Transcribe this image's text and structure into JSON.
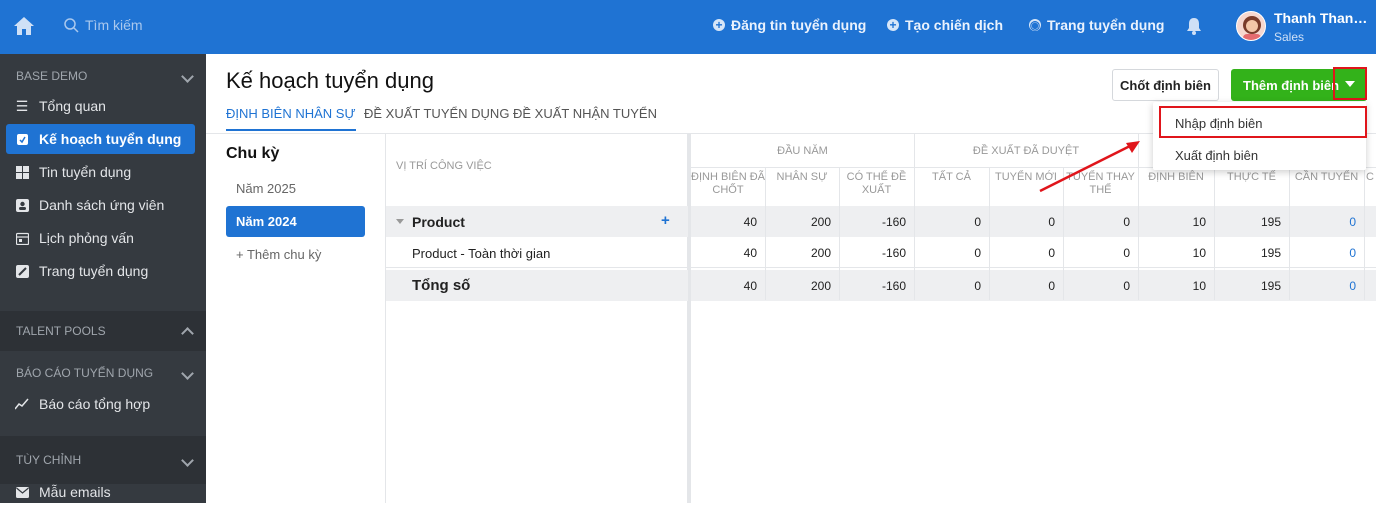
{
  "topbar": {
    "search_placeholder": "Tìm kiếm",
    "nav": [
      "Đăng tin tuyển dụng",
      "Tạo chiến dịch",
      "Trang tuyển dụng"
    ],
    "user_name": "Thanh Thanh ...",
    "user_role": "Sales"
  },
  "sidebar": {
    "sections": {
      "base": "BASE DEMO",
      "talent": "TALENT POOLS",
      "report": "BÁO CÁO TUYỂN DỤNG",
      "custom": "TÙY CHỈNH"
    },
    "items": [
      {
        "label": "Tổng quan",
        "icon": "menu-icon"
      },
      {
        "label": "Kế hoạch tuyển dụng",
        "icon": "plan-icon",
        "active": true
      },
      {
        "label": "Tin tuyển dụng",
        "icon": "grid-icon"
      },
      {
        "label": "Danh sách ứng viên",
        "icon": "candidate-icon"
      },
      {
        "label": "Lịch phỏng vấn",
        "icon": "calendar-icon"
      },
      {
        "label": "Trang tuyển dụng",
        "icon": "page-icon"
      },
      {
        "label": "Báo cáo tổng hợp",
        "icon": "chart-icon"
      },
      {
        "label": "Mẫu emails",
        "icon": "mail-icon"
      }
    ]
  },
  "page": {
    "title": "Kế hoạch tuyển dụng",
    "tabs": [
      "ĐỊNH BIÊN NHÂN SỰ",
      "ĐỀ XUẤT TUYỂN DỤNG",
      "ĐỀ XUẤT NHẬN TUYỂN"
    ],
    "btn_chot": "Chốt định biên",
    "btn_them": "Thêm định biên",
    "dropdown": [
      "Nhập định biên",
      "Xuất định biên"
    ]
  },
  "cycles": {
    "title": "Chu kỳ",
    "items": [
      "Năm 2025",
      "Năm 2024"
    ],
    "add": "+ Thêm chu kỳ"
  },
  "table": {
    "pos_header": "VỊ TRÍ CÔNG VIỆC",
    "groups": [
      "ĐẦU NĂM",
      "ĐỀ XUẤT ĐÃ DUYỆT"
    ],
    "columns": [
      "ĐỊNH BIÊN ĐÃ CHỐT",
      "NHÂN SỰ",
      "CÓ THỂ ĐỀ XUẤT",
      "TẤT CẢ",
      "TUYỂN MỚI",
      "TUYỂN THAY THẾ",
      "ĐỊNH BIÊN",
      "THỰC TẾ",
      "CẦN TUYỂN",
      "C"
    ],
    "rows": [
      {
        "label": "Product",
        "values": [
          "40",
          "200",
          "-160",
          "0",
          "0",
          "0",
          "10",
          "195",
          "0"
        ]
      },
      {
        "label": "Product - Toàn thời gian",
        "values": [
          "40",
          "200",
          "-160",
          "0",
          "0",
          "0",
          "10",
          "195",
          "0"
        ]
      },
      {
        "label": "Tổng số",
        "values": [
          "40",
          "200",
          "-160",
          "0",
          "0",
          "0",
          "10",
          "195",
          "0"
        ]
      }
    ]
  },
  "colors": {
    "primary": "#1f73d3",
    "green": "#33b21a",
    "highlight": "#e0151b",
    "sidebar": "#353a40"
  }
}
